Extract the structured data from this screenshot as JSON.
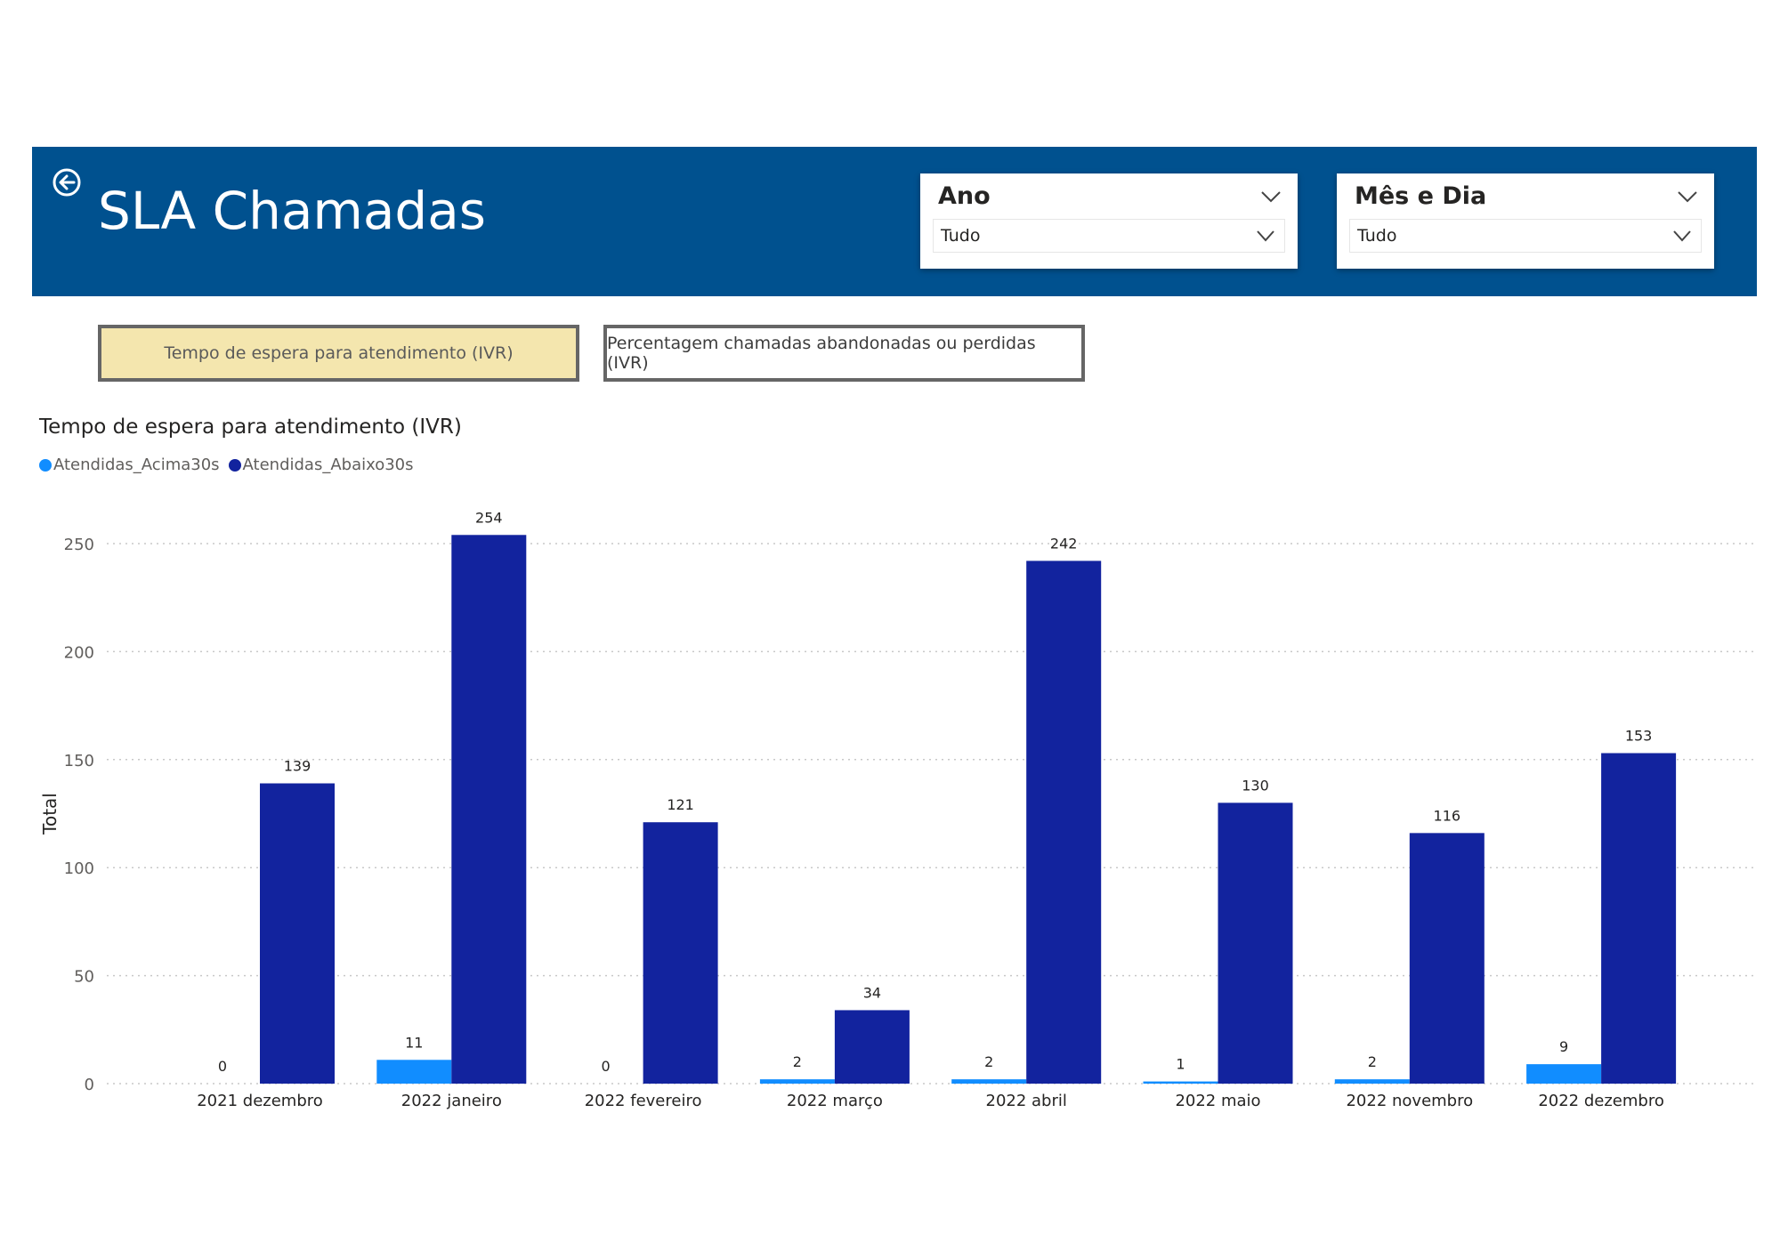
{
  "header": {
    "title": "SLA Chamadas",
    "background_color": "#00518F",
    "back_icon": "back-arrow-circle-icon"
  },
  "slicers": [
    {
      "label": "Ano",
      "value": "Tudo"
    },
    {
      "label": "Mês e Dia",
      "value": "Tudo"
    }
  ],
  "tabs": [
    {
      "label": "Tempo de espera para atendimento (IVR)",
      "active": true
    },
    {
      "label": "Percentagem chamadas abandonadas ou perdidas (IVR)",
      "active": false
    }
  ],
  "chart": {
    "title": "Tempo de espera para atendimento (IVR)"
  },
  "chart_data": {
    "type": "bar",
    "title": "Tempo de espera para atendimento (IVR)",
    "xlabel": "",
    "ylabel": "Total",
    "ylim": [
      0,
      250
    ],
    "yticks": [
      0,
      50,
      100,
      150,
      200,
      250
    ],
    "grid": true,
    "legend_position": "top-left",
    "categories": [
      "2021 dezembro",
      "2022 janeiro",
      "2022 fevereiro",
      "2022 março",
      "2022 abril",
      "2022 maio",
      "2022 novembro",
      "2022 dezembro"
    ],
    "series": [
      {
        "name": "Atendidas_Acima30s",
        "color": "#118DFF",
        "values": [
          0,
          11,
          0,
          2,
          2,
          1,
          2,
          9
        ]
      },
      {
        "name": "Atendidas_Abaixo30s",
        "color": "#12239E",
        "values": [
          139,
          254,
          121,
          34,
          242,
          130,
          116,
          153
        ]
      }
    ]
  }
}
